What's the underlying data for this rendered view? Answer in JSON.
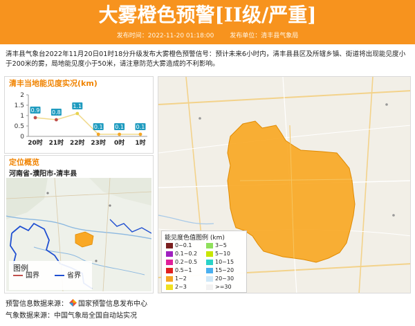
{
  "header": {
    "title": "大雾橙色预警[II级/严重]",
    "publish_time": "发布时间：2022-11-20 01:18:00",
    "publisher": "发布单位：清丰县气象局"
  },
  "description": "清丰县气象台2022年11月20日01时18分升级发布大雾橙色预警信号：预计未来6小时内，清丰县县区及所辖乡镇、街道将出现能见度小于200米的雾，局地能见度小于50米，请注意防范大雾造成的不利影响。",
  "visibility_panel": {
    "title": "清丰当地能见度实况(km)"
  },
  "chart_data": {
    "type": "line",
    "title": "清丰当地能见度实况(km)",
    "categories": [
      "20时",
      "21时",
      "22时",
      "23时",
      "0时",
      "1时"
    ],
    "values": [
      0.9,
      0.8,
      1.1,
      0.1,
      0.1,
      0.1
    ],
    "labels": [
      "0.9",
      "0.8",
      "1.1",
      "0.1",
      "0.1",
      "0.1"
    ],
    "yticks": [
      "0",
      "0.5",
      "1",
      "1.5",
      "2"
    ],
    "ylim": [
      0,
      2
    ],
    "point_colors": [
      "#c0504d",
      "#c0504d",
      "#e8d44d",
      "#f5a623",
      "#f5a623",
      "#f5a623"
    ],
    "label_bg": "#1f9bbf"
  },
  "location_panel": {
    "title": "定位概览",
    "location": "河南省-濮阳市-清丰县",
    "legend_title": "图例",
    "legend_border": "国界",
    "legend_province": "省界",
    "border_color": "#c0504d",
    "province_color": "#1f4fd1"
  },
  "map_legend": {
    "title": "能见度色值图例 (km)",
    "items": [
      {
        "label": "0~0.1",
        "color": "#7a1f1f"
      },
      {
        "label": "3~5",
        "color": "#8fe05c"
      },
      {
        "label": "0.1~0.2",
        "color": "#a020c0"
      },
      {
        "label": "5~10",
        "color": "#c8e600"
      },
      {
        "label": "0.2~0.5",
        "color": "#e0209a"
      },
      {
        "label": "10~15",
        "color": "#2ad3c8"
      },
      {
        "label": "0.5~1",
        "color": "#e02020"
      },
      {
        "label": "15~20",
        "color": "#4ab0f0"
      },
      {
        "label": "1~2",
        "color": "#f5a623"
      },
      {
        "label": "20~30",
        "color": "#cfe8f8"
      },
      {
        "label": "2~3",
        "color": "#f0e020"
      },
      {
        "label": ">=30",
        "color": "#f2f2f2"
      }
    ]
  },
  "footer": {
    "warning_source": "预警信息数据来源：",
    "warning_source_name": "国家预警信息发布中心",
    "weather_source": "气象数据来源：中国气象局全国自动站实况"
  },
  "colors": {
    "header_orange": "#f7931e",
    "warn_area": "#f9a825"
  }
}
